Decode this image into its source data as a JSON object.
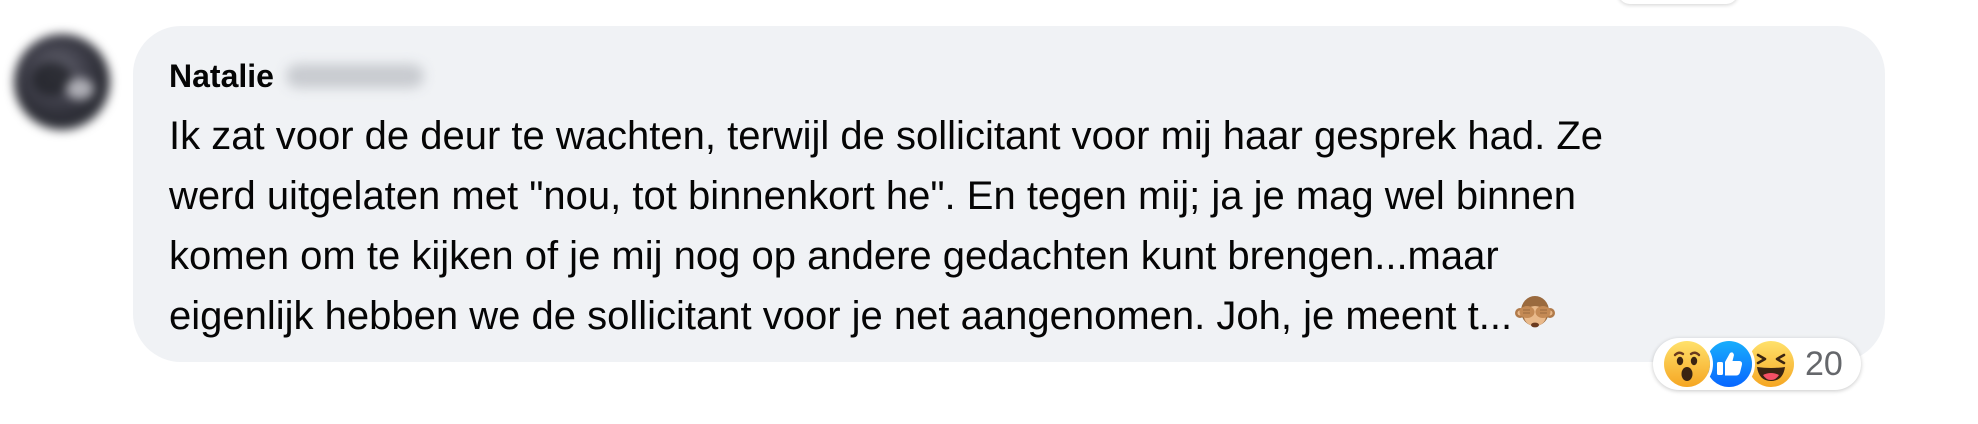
{
  "comment": {
    "author_first_name": "Natalie",
    "text": "Ik zat voor de deur te wachten, terwijl de sollicitant voor mij haar gesprek had. Ze\nwerd uitgelaten met \"nou, tot binnenkort he\". En tegen mij; ja je mag wel binnen\nkomen om te kijken of je mij nog op andere gedachten kunt brengen...maar\neigenlijk hebben we de sollicitant voor je net aangenomen. Joh, je meent t...",
    "trailing_emoji_icon": "see-no-evil-monkey-icon"
  },
  "reactions": {
    "icons": [
      "wow-reaction-icon",
      "like-reaction-icon",
      "haha-reaction-icon"
    ],
    "count": "20"
  },
  "colors": {
    "bubble_background": "#f0f2f5",
    "text": "#050505",
    "secondary_text": "#65676b",
    "like_blue": "#1877f2",
    "reaction_yellow": "#fcc33c"
  }
}
